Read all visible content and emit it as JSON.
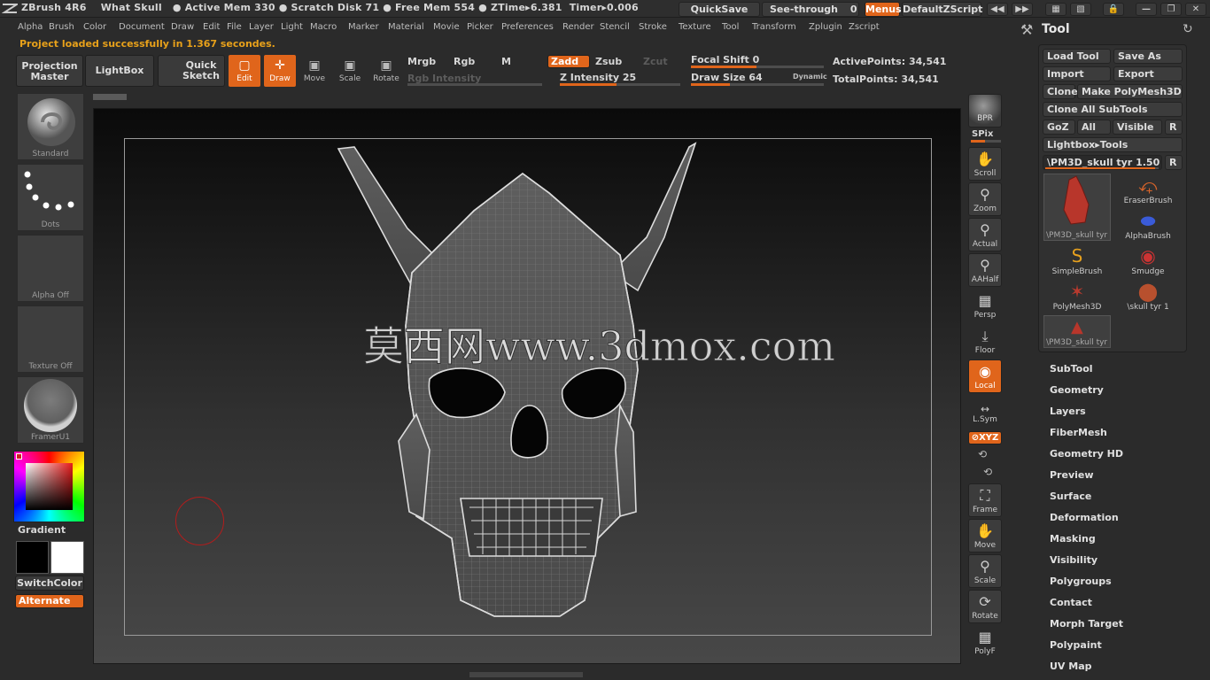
{
  "titlebar": {
    "info": "ZBrush 4R6    What Skull   ● Active Mem 330 ● Scratch Disk 71 ● Free Mem 554 ● ZTime▸6.381  Timer▸0.006",
    "quicksave": "QuickSave",
    "seethrough": "See-through",
    "seethrough_value": "0",
    "menus": "Menus",
    "script": "DefaultZScript"
  },
  "menu": [
    "Alpha",
    "Brush",
    "Color",
    "Document",
    "Draw",
    "Edit",
    "File",
    "Layer",
    "Light",
    "Macro",
    "Marker",
    "Material",
    "Movie",
    "Picker",
    "Preferences",
    "Render",
    "Stencil",
    "Stroke",
    "Texture",
    "Tool",
    "Transform",
    "Zplugin",
    "Zscript"
  ],
  "status": "Project loaded successfully in 1.367 secondes.",
  "shelf": {
    "projection_master": [
      "Projection",
      "Master"
    ],
    "lightbox": "LightBox",
    "quick_sketch": [
      "Quick",
      "Sketch"
    ],
    "edit": "Edit",
    "draw": "Draw",
    "move": "Move",
    "scale": "Scale",
    "rotate": "Rotate",
    "mrgb": "Mrgb",
    "rgb": "Rgb",
    "m": "M",
    "zadd": "Zadd",
    "zsub": "Zsub",
    "zcut": "Zcut",
    "rgb_intensity": "Rgb Intensity",
    "z_intensity_label": "Z Intensity",
    "z_intensity": "25",
    "focal_shift_label": "Focal Shift",
    "focal_shift": "0",
    "draw_size_label": "Draw Size",
    "draw_size": "64",
    "dynamic": "Dynamic",
    "active_points_label": "ActivePoints:",
    "active_points": "34,541",
    "total_points_label": "TotalPoints:",
    "total_points": "34,541"
  },
  "left": {
    "brush": "Standard",
    "stroke": "Dots",
    "alpha": "Alpha  Off",
    "texture": "Texture  Off",
    "material": "FramerU1",
    "gradient": "Gradient",
    "switch_color": "SwitchColor",
    "alternate": "Alternate"
  },
  "canvas": {
    "watermark": "莫西网www.3dmox.com"
  },
  "right_tools": {
    "bpr": "BPR",
    "spix": "SPix",
    "scroll": "Scroll",
    "zoom": "Zoom",
    "actual": "Actual",
    "aahalf": "AAHalf",
    "persp": "Persp",
    "floor": "Floor",
    "local": "Local",
    "lsym": "L.Sym",
    "xyz": "⊘XYZ",
    "frame": "Frame",
    "move": "Move",
    "scale": "Scale",
    "rotate": "Rotate",
    "polyf": "PolyF"
  },
  "tool": {
    "title": "Tool",
    "load_tool": "Load Tool",
    "save_as": "Save As",
    "import": "Import",
    "export": "Export",
    "clone": "Clone",
    "make_polymesh": "Make PolyMesh3D",
    "clone_all": "Clone  All SubTools",
    "goz": "GoZ",
    "all": "All",
    "visible": "Visible",
    "r": "R",
    "lightbox_tools": "Lightbox▸Tools",
    "current_tool": "\\PM3D_skull tyr",
    "current_value": "1.50",
    "current_thumb": "\\PM3D_skull tyr",
    "brushes": [
      "EraserBrush",
      "AlphaBrush",
      "SimpleBrush",
      "Smudge",
      "PolyMesh3D",
      "\\skull tyr 1"
    ],
    "thumb2": "\\PM3D_skull tyr",
    "sections": [
      "SubTool",
      "Geometry",
      "Layers",
      "FiberMesh",
      "Geometry HD",
      "Preview",
      "Surface",
      "Deformation",
      "Masking",
      "Visibility",
      "Polygroups",
      "Contact",
      "Morph Target",
      "Polypaint",
      "UV Map"
    ]
  }
}
